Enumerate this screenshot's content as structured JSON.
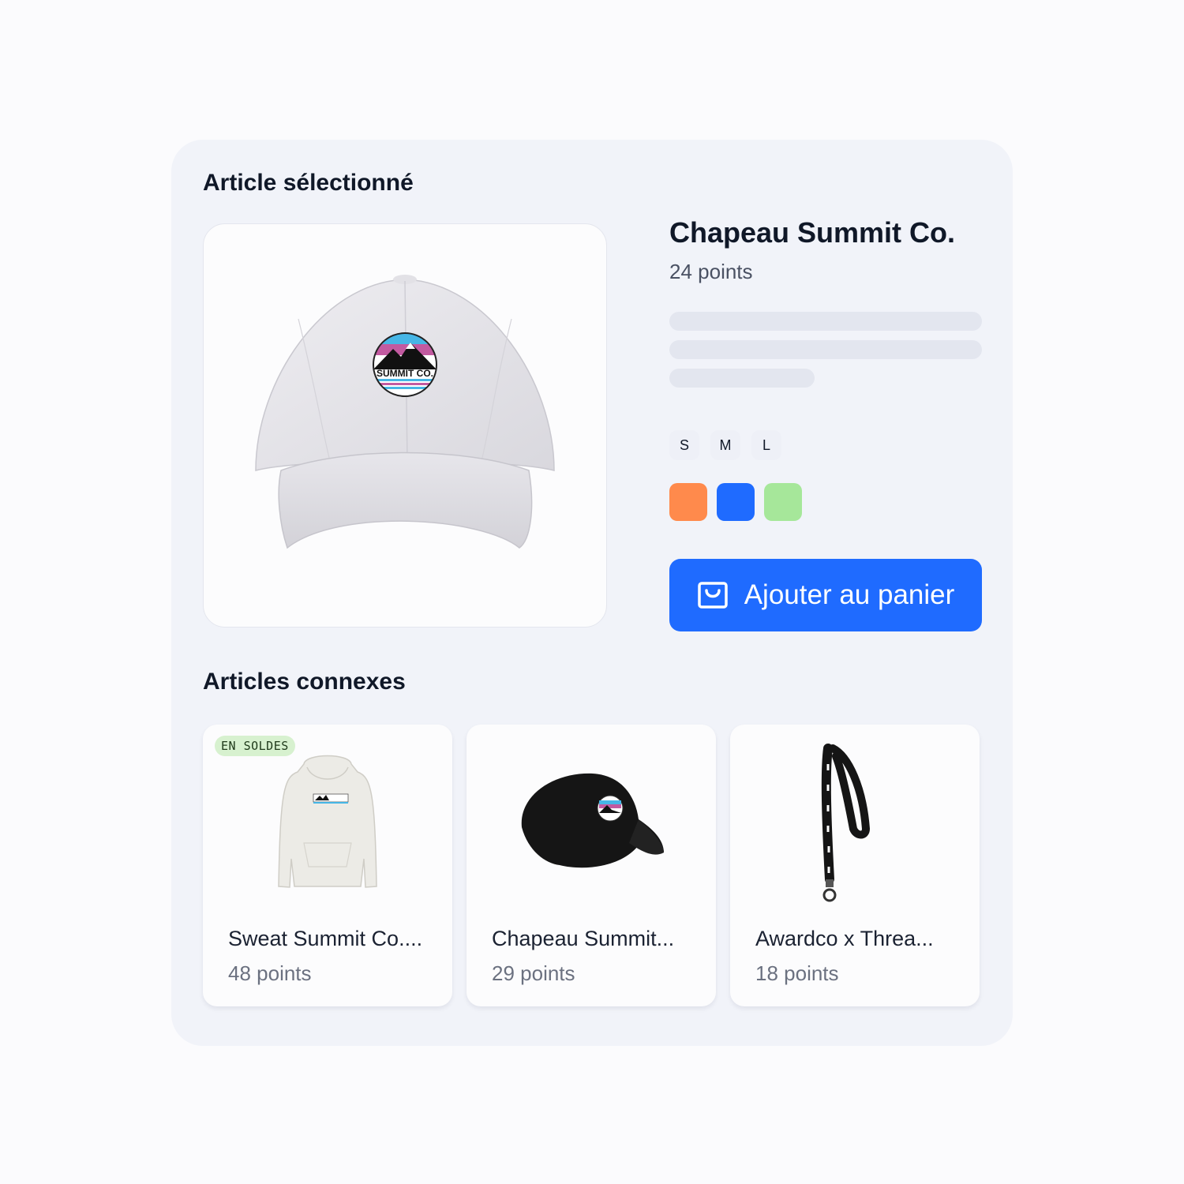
{
  "selected": {
    "section_title": "Article sélectionné",
    "product_name": "Chapeau Summit Co.",
    "points": "24 points",
    "logo_text": "SUMMIT CO.",
    "sizes": [
      "S",
      "M",
      "L"
    ],
    "colors": [
      "#ff8a4c",
      "#1f6bff",
      "#a6e79a"
    ],
    "add_to_cart_label": "Ajouter au panier",
    "cart_icon": "shopping-bag-icon"
  },
  "related": {
    "section_title": "Articles connexes",
    "items": [
      {
        "name": "Sweat Summit Co....",
        "points": "48 points",
        "badge": "EN SOLDES"
      },
      {
        "name": "Chapeau Summit...",
        "points": "29 points"
      },
      {
        "name": "Awardco x Threa...",
        "points": "18 points"
      }
    ]
  }
}
